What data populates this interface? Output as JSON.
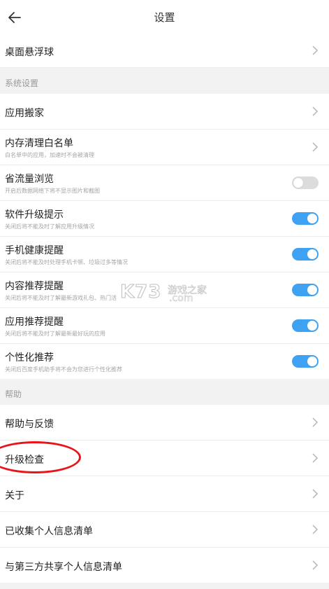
{
  "header": {
    "title": "设置",
    "back_icon": "arrow-left-icon"
  },
  "rows_top": [
    {
      "label": "桌面悬浮球"
    }
  ],
  "system_section": {
    "title": "系统设置",
    "items": [
      {
        "label": "应用搬家",
        "sub": "",
        "control": "chevron"
      },
      {
        "label": "内存清理白名单",
        "sub": "白名单中的应用，加速时不会被清理",
        "control": "chevron"
      },
      {
        "label": "省流量浏览",
        "sub": "开启后数据网络下将不显示图片和截图",
        "control": "toggle",
        "on": false
      },
      {
        "label": "软件升级提示",
        "sub": "关闭后将不能及时了解应用升级情况",
        "control": "toggle",
        "on": true
      },
      {
        "label": "手机健康提醒",
        "sub": "关闭后将不能及时处理手机卡顿、垃圾过多等情况",
        "control": "toggle",
        "on": true
      },
      {
        "label": "内容推荐提醒",
        "sub": "关闭后将不能及时了解最新游戏礼包、热门活",
        "control": "toggle",
        "on": true
      },
      {
        "label": "应用推荐提醒",
        "sub": "关闭后将不能及时了解最新最好玩的应用",
        "control": "toggle",
        "on": true
      },
      {
        "label": "个性化推荐",
        "sub": "关闭后百度手机助手将不会为您进行个性化推荐",
        "control": "toggle",
        "on": true
      }
    ]
  },
  "help_section": {
    "title": "帮助",
    "items": [
      {
        "label": "帮助与反馈"
      },
      {
        "label": "升级检查"
      },
      {
        "label": "关于"
      },
      {
        "label": "已收集个人信息清单"
      },
      {
        "label": "与第三方共享个人信息清单"
      }
    ]
  },
  "watermark": {
    "brand": "K73",
    "text": "游戏之家",
    "domain": ".com"
  },
  "colors": {
    "accent": "#3ea1f2",
    "annotation": "#e8141a",
    "background": "#f2f2f2"
  }
}
